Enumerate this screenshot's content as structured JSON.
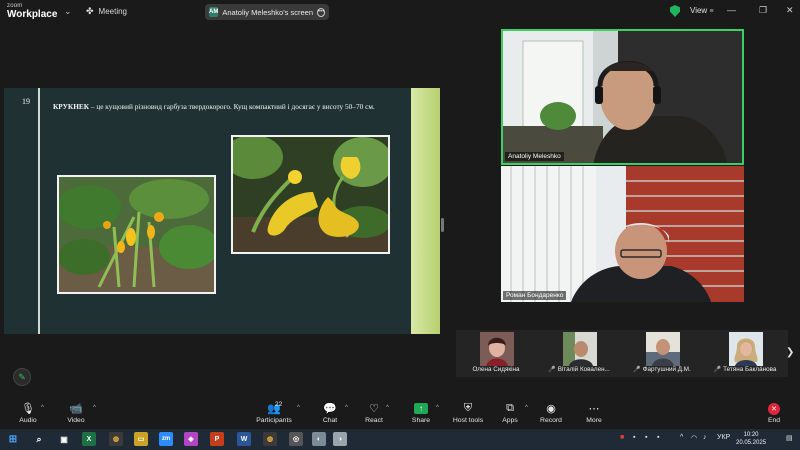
{
  "titlebar": {
    "brand_small": "zoom",
    "brand_big": "Workplace",
    "meeting_label": "Meeting",
    "share_initials": "AM",
    "share_title": "Anatoliy Meleshko's screen",
    "view_label": "View"
  },
  "slide": {
    "number": "19",
    "bold_word": "КРУКНЕК",
    "text": " – це кущовий різновид гарбуза твердокорого. Кущ компактний і досягає у висоту 50–70 см."
  },
  "videos": [
    {
      "name": "Anatoliy Meleshko"
    },
    {
      "name": "Роман Бондаренко"
    }
  ],
  "gallery": [
    {
      "name": "Олена Сидякіна",
      "muted": false
    },
    {
      "name": "Віталій Ковален...",
      "muted": true
    },
    {
      "name": "Фартушний Д.М.",
      "muted": true
    },
    {
      "name": "Тетяна Баклáнова",
      "muted": true
    }
  ],
  "controls": {
    "audio": "Audio",
    "video": "Video",
    "participants": "Participants",
    "participants_count": "22",
    "chat": "Chat",
    "react": "React",
    "share": "Share",
    "host_tools": "Host tools",
    "apps": "Apps",
    "record": "Record",
    "more": "More",
    "end": "End"
  },
  "taskbar": {
    "language": "УКР",
    "time": "10:20",
    "date": "20.05.2025"
  },
  "colors": {
    "active_speaker": "#3fce66",
    "end_red": "#e0263b",
    "share_green": "#1fa855"
  }
}
